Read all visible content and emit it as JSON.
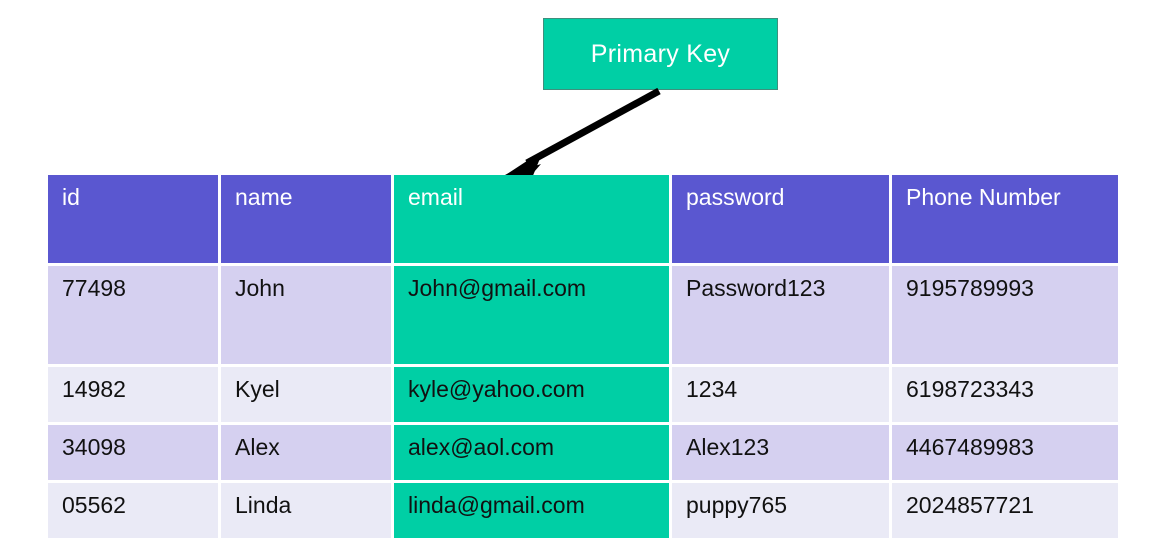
{
  "callout": {
    "label": "Primary Key",
    "box_color": "#00cfa5",
    "text_color": "#ffffff"
  },
  "annotation": {
    "arrow_name": "arrow-primary-key-to-email",
    "arrow_color": "#000000",
    "points_to_column": "email"
  },
  "theme": {
    "header_purple": "#5a57d0",
    "key_teal": "#00cfa5",
    "row_dark": "#d5d0f0",
    "row_light": "#eaeaf6",
    "text_dark": "#111111",
    "text_light": "#ffffff"
  },
  "table": {
    "columns": [
      {
        "label": "id",
        "key": false
      },
      {
        "label": "name",
        "key": false
      },
      {
        "label": "email",
        "key": true
      },
      {
        "label": "password",
        "key": false
      },
      {
        "label": "Phone\nNumber",
        "key": false
      }
    ],
    "rows": [
      {
        "id": "77498",
        "name": "John",
        "email": "John@gmail.com",
        "password": "Password123",
        "phone": "9195789993"
      },
      {
        "id": "14982",
        "name": "Kyel",
        "email": "kyle@yahoo.com",
        "password": "1234",
        "phone": "6198723343"
      },
      {
        "id": "34098",
        "name": "Alex",
        "email": "alex@aol.com",
        "password": "Alex123",
        "phone": "4467489983"
      },
      {
        "id": "05562",
        "name": "Linda",
        "email": "linda@gmail.com",
        "password": "puppy765",
        "phone": "2024857721"
      }
    ]
  }
}
